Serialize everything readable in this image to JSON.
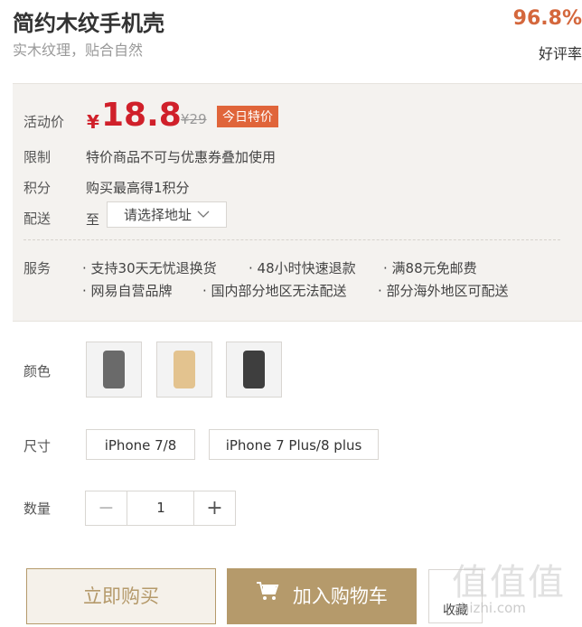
{
  "product": {
    "title": "简约木纹手机壳",
    "subtitle": "实木纹理，贴合自然",
    "rating": "96.8%",
    "rating_label": "好评率"
  },
  "price_panel": {
    "price_label": "活动价",
    "currency": "¥",
    "price": "18.8",
    "original_price": "¥29",
    "badge": "今日特价",
    "limit_label": "限制",
    "limit_text": "特价商品不可与优惠券叠加使用",
    "points_label": "积分",
    "points_text": "购买最高得1积分",
    "delivery_label": "配送",
    "delivery_to": "至",
    "address_placeholder": "请选择地址",
    "service_label": "服务",
    "services": [
      "· 支持30天无忧退换货",
      "· 48小时快速退款",
      "· 满88元免邮费",
      "· 网易自营品牌",
      "· 国内部分地区无法配送",
      "· 部分海外地区可配送"
    ]
  },
  "options": {
    "color_label": "颜色",
    "colors": [
      "#6a6a6a",
      "#e3c38f",
      "#3e3e3e"
    ],
    "size_label": "尺寸",
    "sizes": [
      "iPhone 7/8",
      "iPhone 7 Plus/8 plus"
    ],
    "quantity_label": "数量",
    "quantity": "1",
    "minus": "−",
    "plus": "+"
  },
  "actions": {
    "buy_now": "立即购买",
    "add_to_cart": "加入购物车",
    "favorite": "收藏"
  },
  "watermark": {
    "main": "值值值",
    "sub": "zhizhi.com"
  },
  "colors": {
    "accent": "#b59a6b",
    "price": "#d0202a",
    "badge": "#e0653a",
    "rating": "#d4673c"
  }
}
